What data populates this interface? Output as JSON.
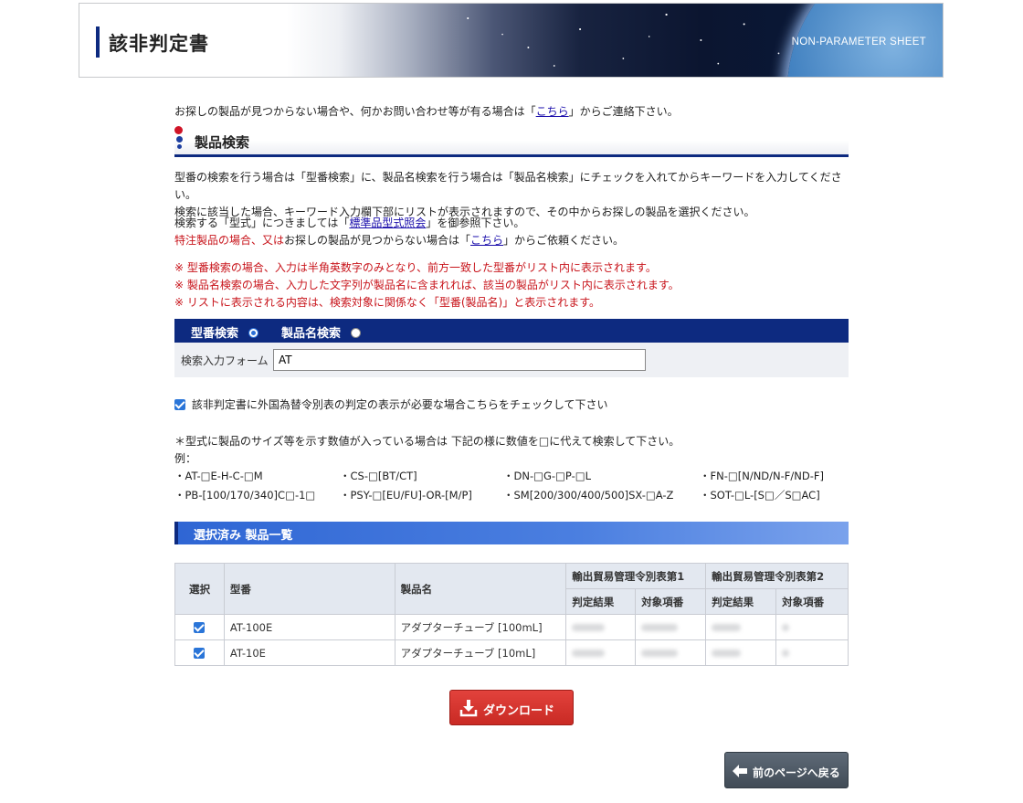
{
  "header": {
    "title": "該非判定書",
    "subtitle": "NON-PARAMETER SHEET"
  },
  "contact_line": {
    "before": "お探しの製品が見つからない場合や、何かお問い合わせ等が有る場合は「",
    "link": "こちら",
    "after": "」からご連絡下さい。"
  },
  "product_search": {
    "heading": "製品検索",
    "intro": [
      "型番の検索を行う場合は「型番検索」に、製品名検索を行う場合は「製品名検索」にチェックを入れてからキーワードを入力してください。",
      "検索に該当した場合、キーワード入力欄下部にリストが表示されますので、その中からお探しの製品を選択ください。"
    ],
    "model_ref": {
      "before": "検索する「型式」につきましては「",
      "link": "標準品型式照会",
      "after": "」を御参照下さい。"
    },
    "special_order": {
      "red": "特注製品の場合、又は",
      "before": "お探しの製品が見つからない場合は「",
      "link": "こちら",
      "after": "」からご依頼ください。"
    },
    "notes": [
      "※ 型番検索の場合、入力は半角英数字のみとなり、前方一致した型番がリスト内に表示されます。",
      "※ 製品名検索の場合、入力した文字列が製品名に含まれれば、該当の製品がリスト内に表示されます。",
      "※ リストに表示される内容は、検索対象に関係なく「型番(製品名)」と表示されます。"
    ],
    "search_tabs": {
      "model_label": "型番検索",
      "model_selected": true,
      "name_label": "製品名検索",
      "name_selected": false
    },
    "input_label": "検索入力フォーム",
    "input_value": "AT",
    "export_check_label": "該非判定書に外国為替令別表の判定の表示が必要な場合こちらをチェックして下さい",
    "export_checked": true,
    "size_note": "＊型式に製品のサイズ等を示す数値が入っている場合は 下記の様に数値を□に代えて検索して下さい。",
    "example_label": "例：",
    "examples": [
      "・AT-□E-H-C-□M",
      "・CS-□[BT/CT]",
      "・DN-□G-□P-□L",
      "・FN-□[N/ND/N-F/ND-F]",
      "・PB-[100/170/340]C□-1□",
      "・PSY-□[EU/FU]-OR-[M/P]",
      "・SM[200/300/400/500]SX-□A-Z",
      "・SOT-□L-[S□／S□AC]"
    ]
  },
  "selected_list": {
    "heading": "選択済み 製品一覧",
    "headers": {
      "select": "選択",
      "model": "型番",
      "name": "製品名",
      "table1": "輸出貿易管理令別表第1",
      "table2": "輸出貿易管理令別表第2",
      "result": "判定結果",
      "item": "対象項番"
    },
    "rows": [
      {
        "checked": true,
        "model": "AT-100E",
        "name": "アダプターチューブ [100mL]"
      },
      {
        "checked": true,
        "model": "AT-10E",
        "name": "アダプターチューブ [10mL]"
      }
    ]
  },
  "buttons": {
    "download": "ダウンロード",
    "back": "前のページへ戻る"
  },
  "colors": {
    "navy": "#0d2a80",
    "accent_blue": "#2f66d4",
    "download_red": "#c92a24",
    "note_red": "#c8141b",
    "back_gray": "#4a5560"
  }
}
